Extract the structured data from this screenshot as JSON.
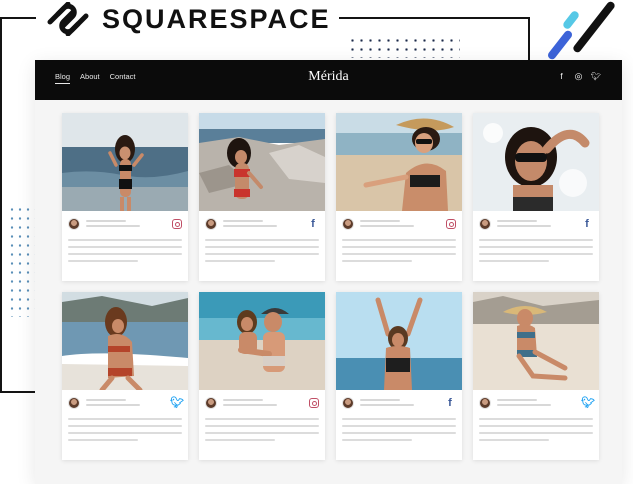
{
  "logo": {
    "text": "SQUARESPACE",
    "icon": "squarespace-logo-icon"
  },
  "site": {
    "title": "Mérida",
    "nav": [
      {
        "label": "Blog",
        "active": true
      },
      {
        "label": "About",
        "active": false
      },
      {
        "label": "Contact",
        "active": false
      }
    ],
    "social_icons": [
      "facebook-icon",
      "instagram-icon",
      "twitter-icon"
    ]
  },
  "cards": [
    {
      "photo": "woman-walking-on-beach-black-bikini",
      "network": "instagram"
    },
    {
      "photo": "woman-sitting-on-rocks-red-bikini",
      "network": "facebook"
    },
    {
      "photo": "woman-with-hat-and-sunglasses-on-sand",
      "network": "instagram"
    },
    {
      "photo": "woman-with-sunglasses-close-up",
      "network": "facebook"
    },
    {
      "photo": "woman-kneeling-at-shoreline",
      "network": "twitter"
    },
    {
      "photo": "couple-piggyback-on-beach",
      "network": "instagram"
    },
    {
      "photo": "woman-arms-raised-sea-background",
      "network": "facebook"
    },
    {
      "photo": "woman-with-straw-hat-sitting-on-sand",
      "network": "twitter"
    }
  ],
  "colors": {
    "navbar": "#0b0b0b",
    "frame": "#141414",
    "accent_blue": "#3c63d8",
    "accent_cyan": "#56c8e6",
    "instagram": "#c04f66",
    "facebook": "#3b5998",
    "twitter": "#1da1f2"
  }
}
